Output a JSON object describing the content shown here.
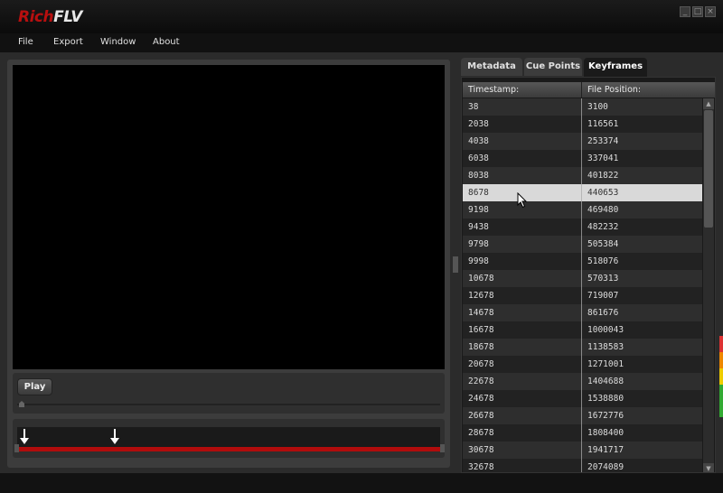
{
  "app": {
    "logo_red": "Rich",
    "logo_white": "FLV"
  },
  "window_controls": [
    {
      "name": "minimize",
      "glyph": "_"
    },
    {
      "name": "maximize",
      "glyph": "□"
    },
    {
      "name": "close",
      "glyph": "×"
    }
  ],
  "menu": [
    "File",
    "Export",
    "Window",
    "About"
  ],
  "player": {
    "play_label": "Play"
  },
  "tabs": [
    {
      "label": "Metadata",
      "active": false
    },
    {
      "label": "Cue Points",
      "active": false
    },
    {
      "label": "Keyframes",
      "active": true
    }
  ],
  "table": {
    "headers": [
      "Timestamp:",
      "File Position:"
    ],
    "selected_index": 5,
    "rows": [
      [
        "38",
        "3100"
      ],
      [
        "2038",
        "116561"
      ],
      [
        "4038",
        "253374"
      ],
      [
        "6038",
        "337041"
      ],
      [
        "8038",
        "401822"
      ],
      [
        "8678",
        "440653"
      ],
      [
        "9198",
        "469480"
      ],
      [
        "9438",
        "482232"
      ],
      [
        "9798",
        "505384"
      ],
      [
        "9998",
        "518076"
      ],
      [
        "10678",
        "570313"
      ],
      [
        "12678",
        "719007"
      ],
      [
        "14678",
        "861676"
      ],
      [
        "16678",
        "1000043"
      ],
      [
        "18678",
        "1138583"
      ],
      [
        "20678",
        "1271001"
      ],
      [
        "22678",
        "1404688"
      ],
      [
        "24678",
        "1538880"
      ],
      [
        "26678",
        "1672776"
      ],
      [
        "28678",
        "1808400"
      ],
      [
        "30678",
        "1941717"
      ],
      [
        "32678",
        "2074089"
      ]
    ]
  },
  "colors": {
    "accent": "#b10c0c",
    "selection": "#d9d9d9",
    "background": "#2b2b2b"
  }
}
